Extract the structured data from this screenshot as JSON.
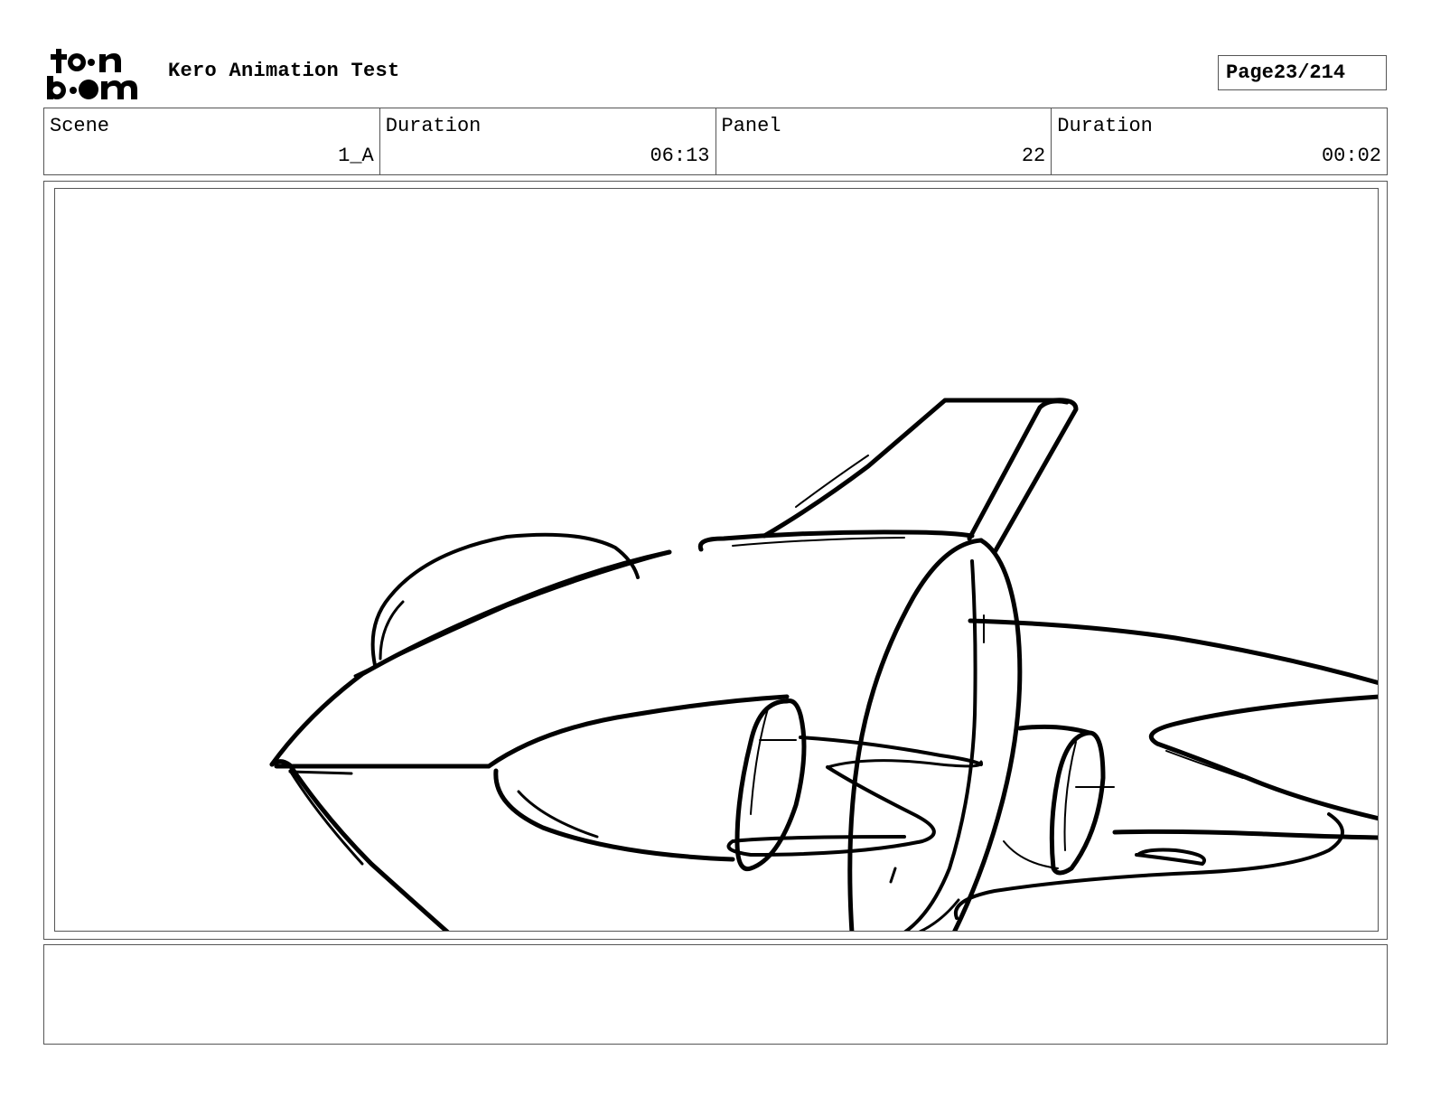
{
  "header": {
    "logo_text": "toon boom",
    "title": "Kero Animation Test",
    "page_label": "Page",
    "page_value": "23/214"
  },
  "info": {
    "scene_label": "Scene",
    "scene_value": "1_A",
    "scene_duration_label": "Duration",
    "scene_duration_value": "06:13",
    "panel_label": "Panel",
    "panel_value": "22",
    "panel_duration_label": "Duration",
    "panel_duration_value": "00:02"
  },
  "notes": {
    "text": ""
  }
}
